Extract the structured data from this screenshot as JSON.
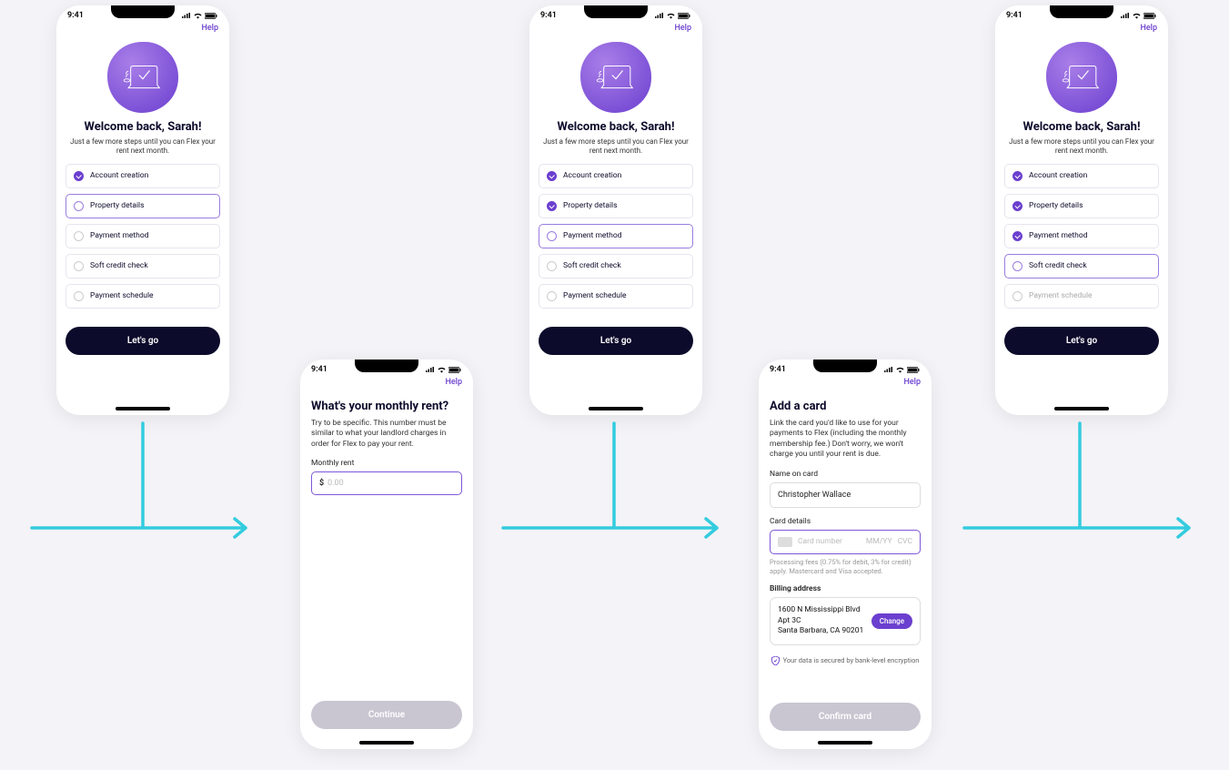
{
  "status": {
    "time": "9:41"
  },
  "help": "Help",
  "welcome": {
    "title": "Welcome back, Sarah!",
    "subtitle": "Just a few more steps until you can Flex your rent next month.",
    "cta": "Let's go",
    "steps": [
      "Account creation",
      "Property details",
      "Payment method",
      "Soft credit check",
      "Payment schedule"
    ]
  },
  "rent": {
    "title": "What's your monthly rent?",
    "body": "Try to be specific. This number must be similar to what your landlord charges in order for Flex to pay your rent.",
    "label": "Monthly rent",
    "prefix": "$",
    "placeholder": "0.00",
    "cta": "Continue"
  },
  "card": {
    "title": "Add a card",
    "body": "Link the card you'd like to use for your payments to Flex (including the monthly membership fee.) Don't worry, we won't charge you until your rent is due.",
    "name_label": "Name on card",
    "name_value": "Christopher Wallace",
    "details_label": "Card details",
    "number_ph": "Card number",
    "exp_ph": "MM/YY",
    "cvc_ph": "CVC",
    "fine": "Processing fees (0.75% for debit, 3% for credit) apply. Mastercard and Visa accepted.",
    "billing_label": "Billing address",
    "addr1": "1600 N Mississippi Blvd",
    "addr2": "Apt 3C",
    "addr3": "Santa Barbara, CA 90201",
    "change": "Change",
    "secure": "Your data is secured by bank-level encryption",
    "cta": "Confirm card"
  }
}
